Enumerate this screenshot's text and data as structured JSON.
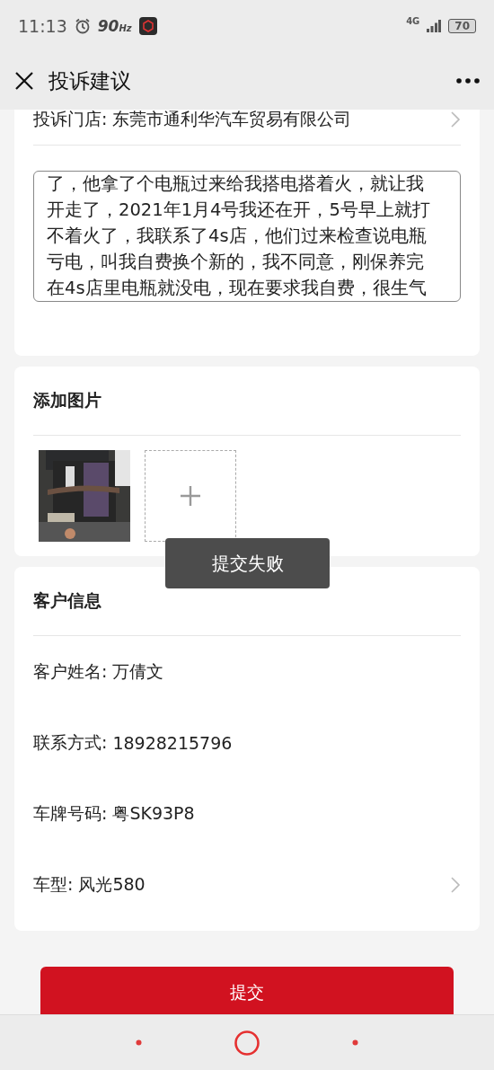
{
  "status_bar": {
    "time": "11:13",
    "refresh": "90",
    "refresh_unit": "Hz",
    "network": "4G",
    "battery": "70"
  },
  "header": {
    "title": "投诉建议"
  },
  "complaint": {
    "store_label": "投诉门店:",
    "store_value": "东莞市通利华汽车贸易有限公司",
    "description_lines": [
      "了，他拿了个电瓶过来给我搭电搭着火，就让我",
      "开走了，2021年1月4号我还在开，5号早上就打",
      "不着火了，我联系了4s店，他们过来检查说电瓶",
      "亏电，叫我自费换个新的，我不同意，刚保养完",
      "在4s店里电瓶就没电，现在要求我自费，很生气"
    ]
  },
  "images": {
    "title": "添加图片"
  },
  "customer": {
    "title": "客户信息",
    "fields": [
      {
        "label": "客户姓名:",
        "value": "万倩文",
        "kind": "text"
      },
      {
        "label": "联系方式:",
        "value": "18928215796",
        "kind": "text"
      },
      {
        "label": "车牌号码:",
        "value": "粤SK93P8",
        "kind": "text"
      },
      {
        "label": "车型:",
        "value": "风光580",
        "kind": "select"
      }
    ]
  },
  "submit": "提交",
  "toast": "提交失败"
}
